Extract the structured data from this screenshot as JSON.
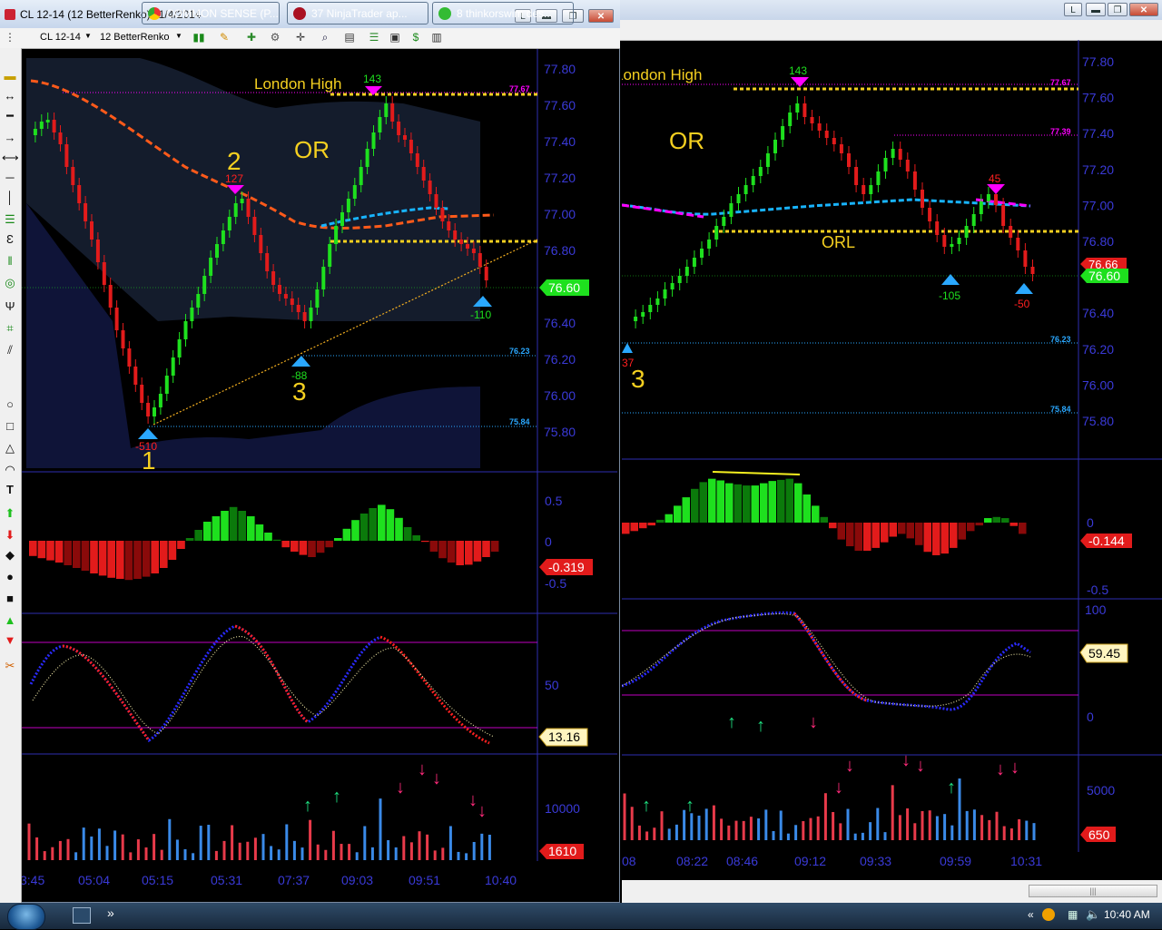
{
  "back_window": {
    "price_axis": [
      "77.80",
      "77.60",
      "77.40",
      "77.20",
      "77.00",
      "76.80",
      "76.40",
      "76.20",
      "76.00",
      "75.80"
    ],
    "price_tags": {
      "last_red": "76.66",
      "last_green": "76.60"
    },
    "ref_levels": {
      "london_high": "77.67",
      "orh": "77.39",
      "orl_below": "76.23",
      "low2": "75.84"
    },
    "labels": {
      "london_high": "London High",
      "or": "OR",
      "orl": "ORL",
      "wave3": "3"
    },
    "swing_labels": {
      "top": "143",
      "mid": "45",
      "low1": "-105",
      "low2": "-50",
      "left": "37"
    },
    "macd": {
      "axis": [
        "0",
        "-0.5"
      ],
      "value": "-0.144"
    },
    "stoch": {
      "axis": [
        "100",
        "0"
      ],
      "value": "59.45"
    },
    "volume": {
      "axis": [
        "5000"
      ],
      "value": "650"
    },
    "time_axis": [
      "08",
      "08:22",
      "08:46",
      "09:12",
      "09:33",
      "09:59",
      "10:31"
    ],
    "scroll_grip": "|||"
  },
  "front_window": {
    "title": "CL 12-14 (12 BetterRenko)  11/4/2014",
    "toolbar": {
      "instrument": "CL 12-14",
      "chart_type": "12 BetterRenko"
    },
    "price_axis": [
      "77.80",
      "77.60",
      "77.40",
      "77.20",
      "77.00",
      "76.80",
      "76.40",
      "76.20",
      "76.00",
      "75.80"
    ],
    "price_tag": "76.60",
    "ref_levels": {
      "london_high": "77.67",
      "low1": "76.23",
      "low2": "75.84"
    },
    "labels": {
      "london_high": "London High",
      "or": "OR",
      "wave1": "1",
      "wave2": "2",
      "wave3": "3"
    },
    "swing_labels": {
      "top": "143",
      "wave2": "127",
      "wave1": "-510",
      "wave3": "-88",
      "last": "-110"
    },
    "macd": {
      "axis": [
        "0.5",
        "0",
        "-0.5"
      ],
      "value": "-0.319"
    },
    "stoch": {
      "axis": [
        "50"
      ],
      "value": "13.16"
    },
    "volume": {
      "axis": [
        "10000"
      ],
      "value": "1610"
    },
    "time_axis": [
      "3:45",
      "05:04",
      "05:15",
      "05:31",
      "07:37",
      "09:03",
      "09:51",
      "10:40"
    ]
  },
  "taskbar": {
    "buttons": [
      {
        "label": "COMMON SENSE (P..."
      },
      {
        "label": "37 NinjaTrader ap..."
      },
      {
        "label": "8 thinkorswim des..."
      }
    ],
    "clock": "10:40 AM",
    "chevron": "«",
    "more": "»"
  },
  "colors": {
    "bull": "#1ee01e",
    "bear": "#e21b1b",
    "bull_dark": "#0b7a0b",
    "bear_dark": "#8a0a0a",
    "level_yellow": "#f5d020",
    "axis_blue": "#3a3ad8",
    "magenta": "#ff00ff"
  }
}
